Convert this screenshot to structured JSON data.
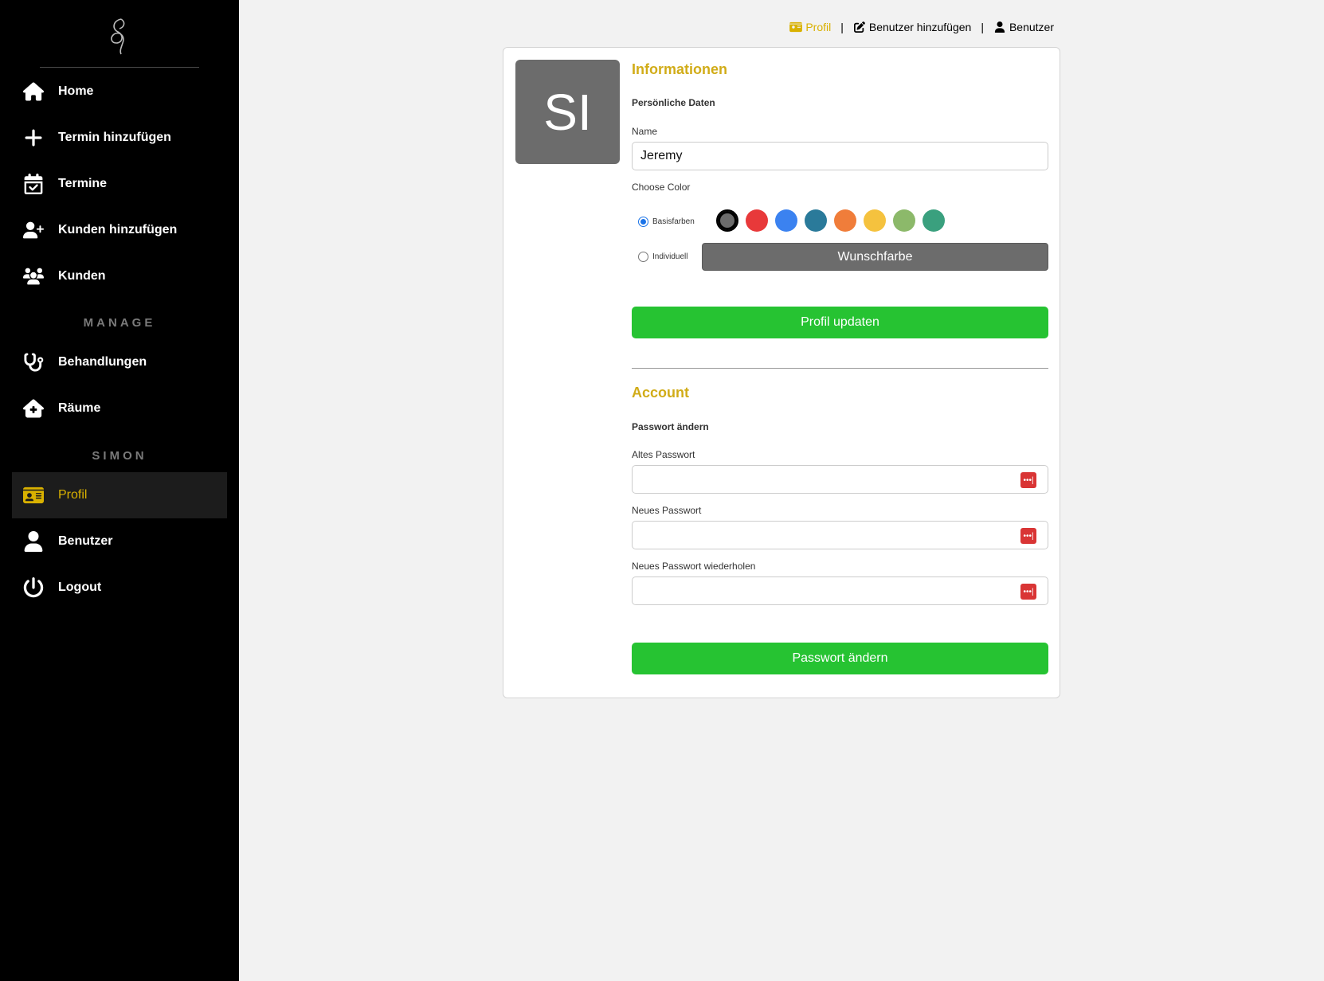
{
  "sidebar": {
    "nav": [
      {
        "label": "Home",
        "icon": "home-icon"
      },
      {
        "label": "Termin hinzufügen",
        "icon": "plus-icon"
      },
      {
        "label": "Termine",
        "icon": "calendar-check-icon"
      },
      {
        "label": "Kunden hinzufügen",
        "icon": "user-plus-icon"
      },
      {
        "label": "Kunden",
        "icon": "users-icon"
      }
    ],
    "manage_heading": "MANAGE",
    "manage": [
      {
        "label": "Behandlungen",
        "icon": "stethoscope-icon"
      },
      {
        "label": "Räume",
        "icon": "house-medical-icon"
      }
    ],
    "user_heading": "SIMON",
    "user": [
      {
        "label": "Profil",
        "icon": "id-card-icon",
        "active": true
      },
      {
        "label": "Benutzer",
        "icon": "user-icon"
      },
      {
        "label": "Logout",
        "icon": "power-icon"
      }
    ]
  },
  "toplinks": [
    {
      "label": "Profil",
      "icon": "id-card-icon",
      "active": true
    },
    {
      "label": "Benutzer hinzufügen",
      "icon": "edit-icon"
    },
    {
      "label": "Benutzer",
      "icon": "user-icon"
    }
  ],
  "profile": {
    "avatar_initials": "SI",
    "info_title": "Informationen",
    "personal_heading": "Persönliche Daten",
    "name_label": "Name",
    "name_value": "Jeremy",
    "color_label": "Choose Color",
    "radio_basic": "Basisfarben",
    "radio_custom": "Individuell",
    "colors": [
      "#6c6c6c",
      "#e8393a",
      "#3b82f0",
      "#2a7a9a",
      "#f07d3a",
      "#f5c23e",
      "#8cb96a",
      "#3aa07e"
    ],
    "selected_color": "#6c6c6c",
    "custom_color_button": "Wunschfarbe",
    "update_button": "Profil updaten"
  },
  "account": {
    "title": "Account",
    "password_heading": "Passwort ändern",
    "old_label": "Altes Passwort",
    "new_label": "Neues Passwort",
    "repeat_label": "Neues Passwort wiederholen",
    "change_button": "Passwort ändern",
    "key_glyph": "•••|"
  },
  "colors": {
    "accent": "#d9b100",
    "green": "#26c332",
    "sidebar_bg": "#000000"
  }
}
